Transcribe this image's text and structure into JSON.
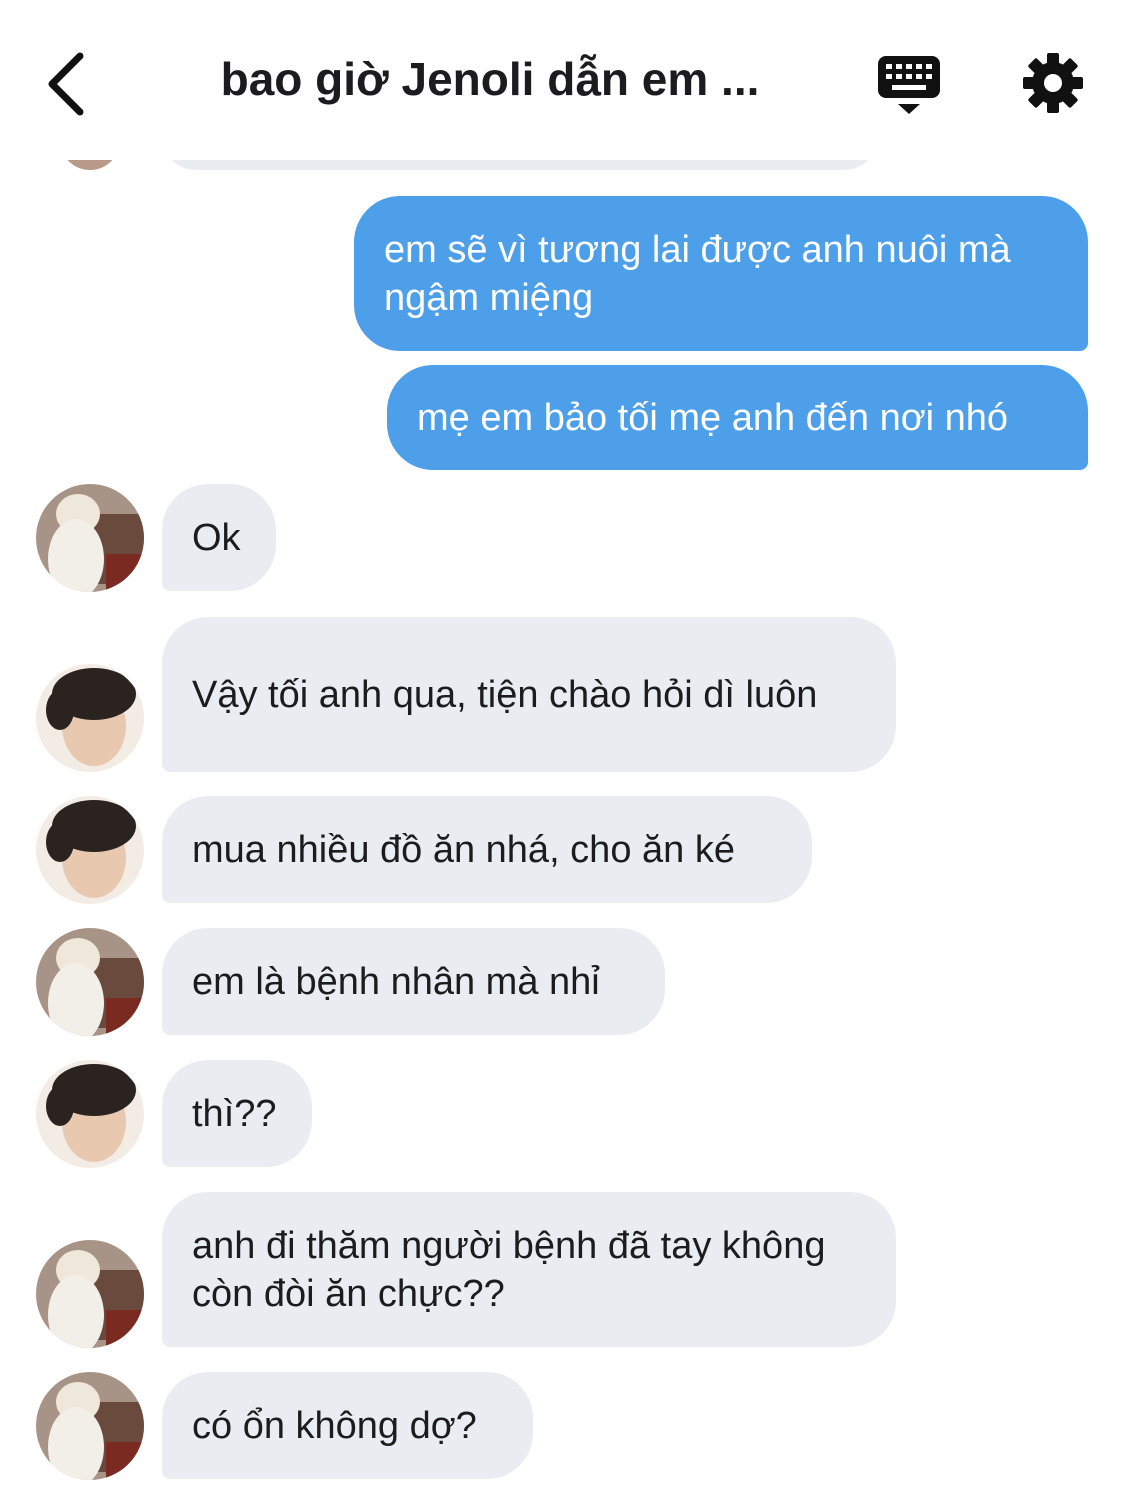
{
  "header": {
    "title": "bao giờ Jenoli dẫn em ...",
    "back_icon": "chevron-left-icon",
    "keyboard_icon": "keyboard-icon",
    "settings_icon": "gear-icon"
  },
  "colors": {
    "outgoing_bubble": "#4e9fe9",
    "incoming_bubble": "#e9edf1"
  },
  "messages": [
    {
      "direction": "out",
      "text": "em sẽ vì tương lai được anh nuôi mà ngậm miệng"
    },
    {
      "direction": "out",
      "text": "mẹ em bảo tối mẹ anh đến nơi nhó"
    },
    {
      "direction": "in",
      "avatar": "avatar-blond",
      "text": "Ok"
    },
    {
      "direction": "in",
      "avatar": "avatar-dark-hair",
      "text": "Vậy tối anh qua, tiện chào hỏi dì luôn"
    },
    {
      "direction": "in",
      "avatar": "avatar-dark-hair",
      "text": "mua nhiều đồ ăn nhá, cho ăn ké"
    },
    {
      "direction": "in",
      "avatar": "avatar-blond",
      "text": "em là bệnh nhân mà nhỉ"
    },
    {
      "direction": "in",
      "avatar": "avatar-dark-hair",
      "text": "thì??"
    },
    {
      "direction": "in",
      "avatar": "avatar-blond",
      "text": "anh đi thăm người bệnh đã tay không còn đòi ăn chực??"
    },
    {
      "direction": "in",
      "avatar": "avatar-blond",
      "text": "có ổn không dợ?"
    }
  ]
}
